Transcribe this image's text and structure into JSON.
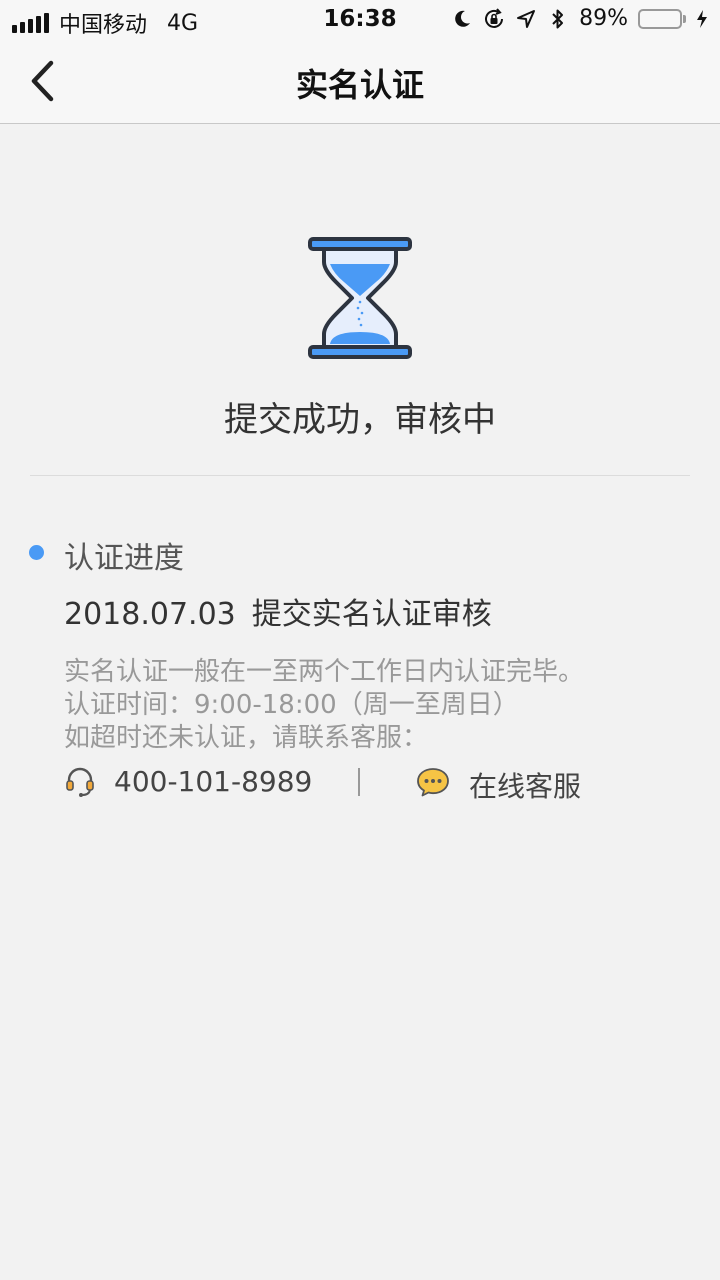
{
  "status_bar": {
    "carrier": "中国移动",
    "network": "4G",
    "time": "16:38",
    "battery": "89%",
    "battery_level": 0.89
  },
  "nav": {
    "title": "实名认证"
  },
  "result": {
    "title": "提交成功，审核中"
  },
  "progress": {
    "label": "认证进度",
    "date": "2018.07.03",
    "event": "提交实名认证审核"
  },
  "notes": {
    "line1": "实名认证一般在一至两个工作日内认证完毕。",
    "line2": "认证时间：9:00-18:00（周一至周日）",
    "line3": "如超时还未认证，请联系客服："
  },
  "contact": {
    "phone": "400-101-8989",
    "online_service": "在线客服"
  },
  "colors": {
    "accent_blue": "#4a9af5",
    "background": "#f2f2f2",
    "battery_green": "#4cd964"
  }
}
